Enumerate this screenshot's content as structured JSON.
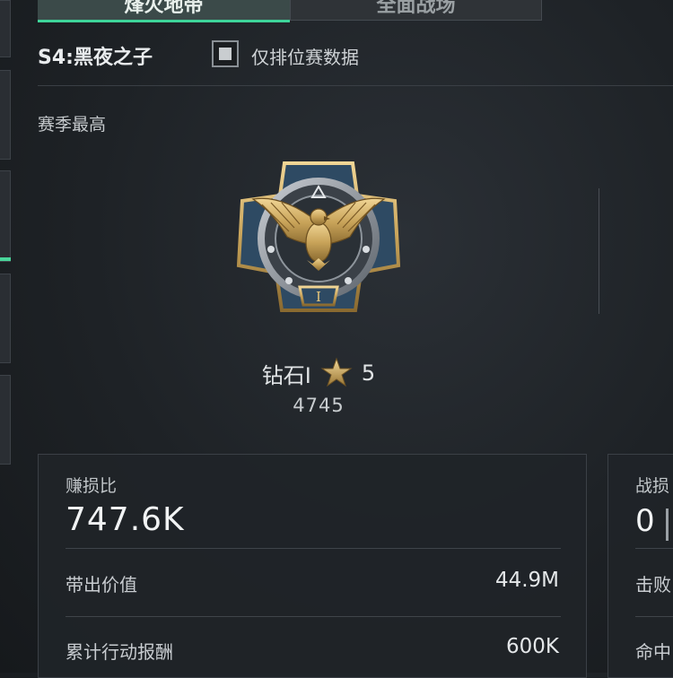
{
  "tabs": [
    {
      "label": "烽火地带"
    },
    {
      "label": "全面战场"
    }
  ],
  "season": {
    "title": "S4:黑夜之子",
    "ranked_only_label": "仅排位赛数据"
  },
  "season_best": {
    "title": "赛季最高",
    "rank_name": "钻石I",
    "stars": "5",
    "score": "4745",
    "badge_tier": "I",
    "icons": [
      "eagle-rank-badge-icon",
      "star-icon"
    ]
  },
  "stats_card": {
    "label": "赚损比",
    "value": "747.6K",
    "rows": [
      {
        "label": "带出价值",
        "value": "44.9M"
      },
      {
        "label": "累计行动报酬",
        "value": "600K"
      }
    ]
  },
  "side_card": {
    "label": "战损",
    "value": "0",
    "rows": [
      {
        "label": "击败"
      },
      {
        "label": "命中"
      }
    ]
  },
  "colors": {
    "accent": "#3ed59a",
    "background": "#1e2226",
    "badge_gold": "#c9a45a",
    "badge_blue": "#2e4a63"
  }
}
